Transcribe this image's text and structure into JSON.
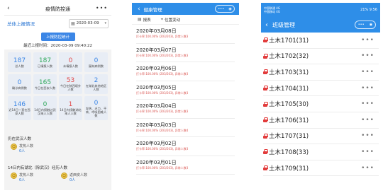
{
  "panel1": {
    "title": "疫情防控通",
    "summary_label": "总体上报情况",
    "date_value": "2020-03-09",
    "button_label": "上报防控统计",
    "report_time": "最近上报时间：2020-03-09 09:40:22",
    "grid": [
      {
        "num": "187",
        "label": "总人数",
        "color": "#3b86e6"
      },
      {
        "num": "187",
        "label": "已填报人数",
        "color": "#2ea85a"
      },
      {
        "num": "0",
        "label": "未填报人数",
        "color": "#e14b4b"
      },
      {
        "num": "0",
        "label": "疑似病例数",
        "color": "#3b86e6"
      },
      {
        "num": "0",
        "label": "确诊病例数",
        "color": "#3b86e6"
      },
      {
        "num": "165",
        "label": "今日在西安人数",
        "color": "#2ea85a"
      },
      {
        "num": "53",
        "label": "今日在陕西境外人数",
        "color": "#e14b4b"
      },
      {
        "num": "2",
        "label": "在湖北其他地区人数",
        "color": "#3b86e6"
      },
      {
        "num": "146",
        "label": "近14日一直在西安人数",
        "color": "#3b86e6"
      },
      {
        "num": "0",
        "label": "14日内接触过武汉来人人数",
        "color": "#2ea85a"
      },
      {
        "num": "1",
        "label": "14日内接触湖北来人人数",
        "color": "#e14b4b"
      },
      {
        "num": "0",
        "label": "发热、乏力、干咳、呼吸困难人数",
        "color": "#3b86e6"
      }
    ],
    "section1": "仍在武汉人数",
    "p1_label": "发热人数",
    "p1_value": "0人",
    "section2": "14日内有湖北（除武汉）经历人数",
    "p2_label": "发热人数",
    "p2_value": "0人",
    "p3_label": "返西安人数",
    "p3_value": "0人"
  },
  "panel2": {
    "title": "健康管理",
    "tab1": "报表",
    "tab2": "位置变动",
    "rows": [
      {
        "date": "2020年03月08日",
        "stat": "打卡率:100.00% (203/203), 异常人数3"
      },
      {
        "date": "2020年03月07日",
        "stat": "打卡率:100.00% (203/203), 异常人数3"
      },
      {
        "date": "2020年03月06日",
        "stat": "打卡率:100.00% (203/203), 异常人数3"
      },
      {
        "date": "2020年03月05日",
        "stat": "打卡率:100.00% (203/203), 异常人数3"
      },
      {
        "date": "2020年03月04日",
        "stat": "打卡率:100.00% (203/203), 异常人数3"
      },
      {
        "date": "2020年03月03日",
        "stat": "打卡率:100.00% (203/203), 异常人数4"
      },
      {
        "date": "2020年03月02日",
        "stat": "打卡率:100.00% (203/203), 异常人数3"
      },
      {
        "date": "2020年03月01日",
        "stat": "打卡率:100.00% (203/203), 异常人数3"
      }
    ]
  },
  "panel3": {
    "status_left1": "中国联通 4G",
    "status_left2": "中国移动 4G",
    "status_right": "21% 9:56",
    "title": "班级管理",
    "rows": [
      "土木1701(31)",
      "土木1702(32)",
      "土木1703(31)",
      "土木1704(31)",
      "土木1705(30)",
      "土木1706(31)",
      "土木1707(31)",
      "土木1708(33)",
      "土木1709(31)"
    ]
  }
}
